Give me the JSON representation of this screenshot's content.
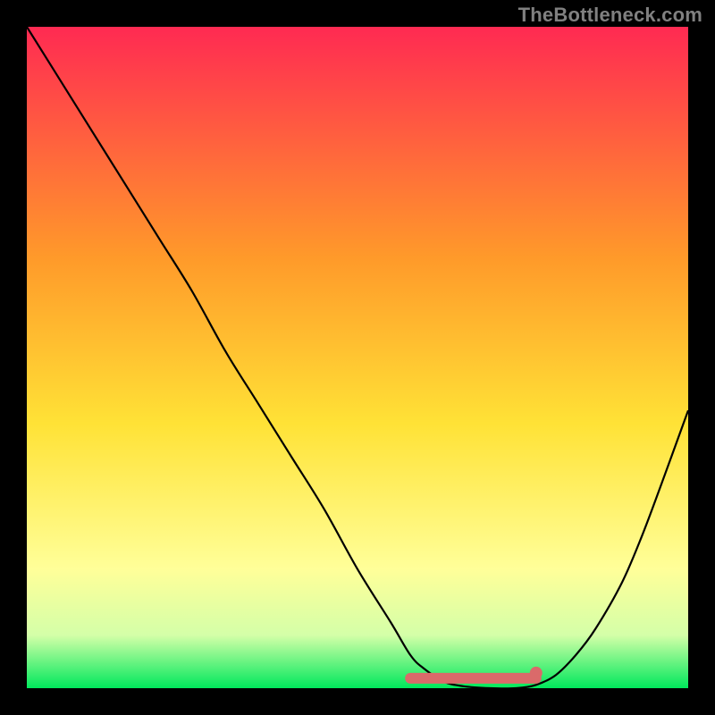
{
  "watermark": "TheBottleneck.com",
  "chart_data": {
    "type": "line",
    "title": "",
    "xlabel": "",
    "ylabel": "",
    "xlim": [
      0,
      100
    ],
    "ylim": [
      0,
      100
    ],
    "grid": false,
    "legend": false,
    "background_gradient": [
      {
        "stop": 0.0,
        "color": "#ff2a52"
      },
      {
        "stop": 0.35,
        "color": "#ff9a2a"
      },
      {
        "stop": 0.6,
        "color": "#ffe236"
      },
      {
        "stop": 0.82,
        "color": "#ffff99"
      },
      {
        "stop": 0.92,
        "color": "#d4ffa8"
      },
      {
        "stop": 1.0,
        "color": "#00e85c"
      }
    ],
    "series": [
      {
        "name": "bottleneck-curve",
        "color": "#000000",
        "x": [
          0,
          5,
          10,
          15,
          20,
          25,
          30,
          35,
          40,
          45,
          50,
          55,
          58,
          60,
          63,
          66,
          70,
          74,
          77,
          80,
          83,
          86,
          90,
          93,
          96,
          100
        ],
        "y": [
          100,
          92,
          84,
          76,
          68,
          60,
          51,
          43,
          35,
          27,
          18,
          10,
          5,
          3,
          1,
          0.3,
          0,
          0,
          0.5,
          2,
          5,
          9,
          16,
          23,
          31,
          42
        ]
      }
    ],
    "optimal_band": {
      "name": "optimal-range-marker",
      "color": "#da6a6a",
      "x_start": 58,
      "x_end": 77,
      "y": 1.5
    }
  }
}
